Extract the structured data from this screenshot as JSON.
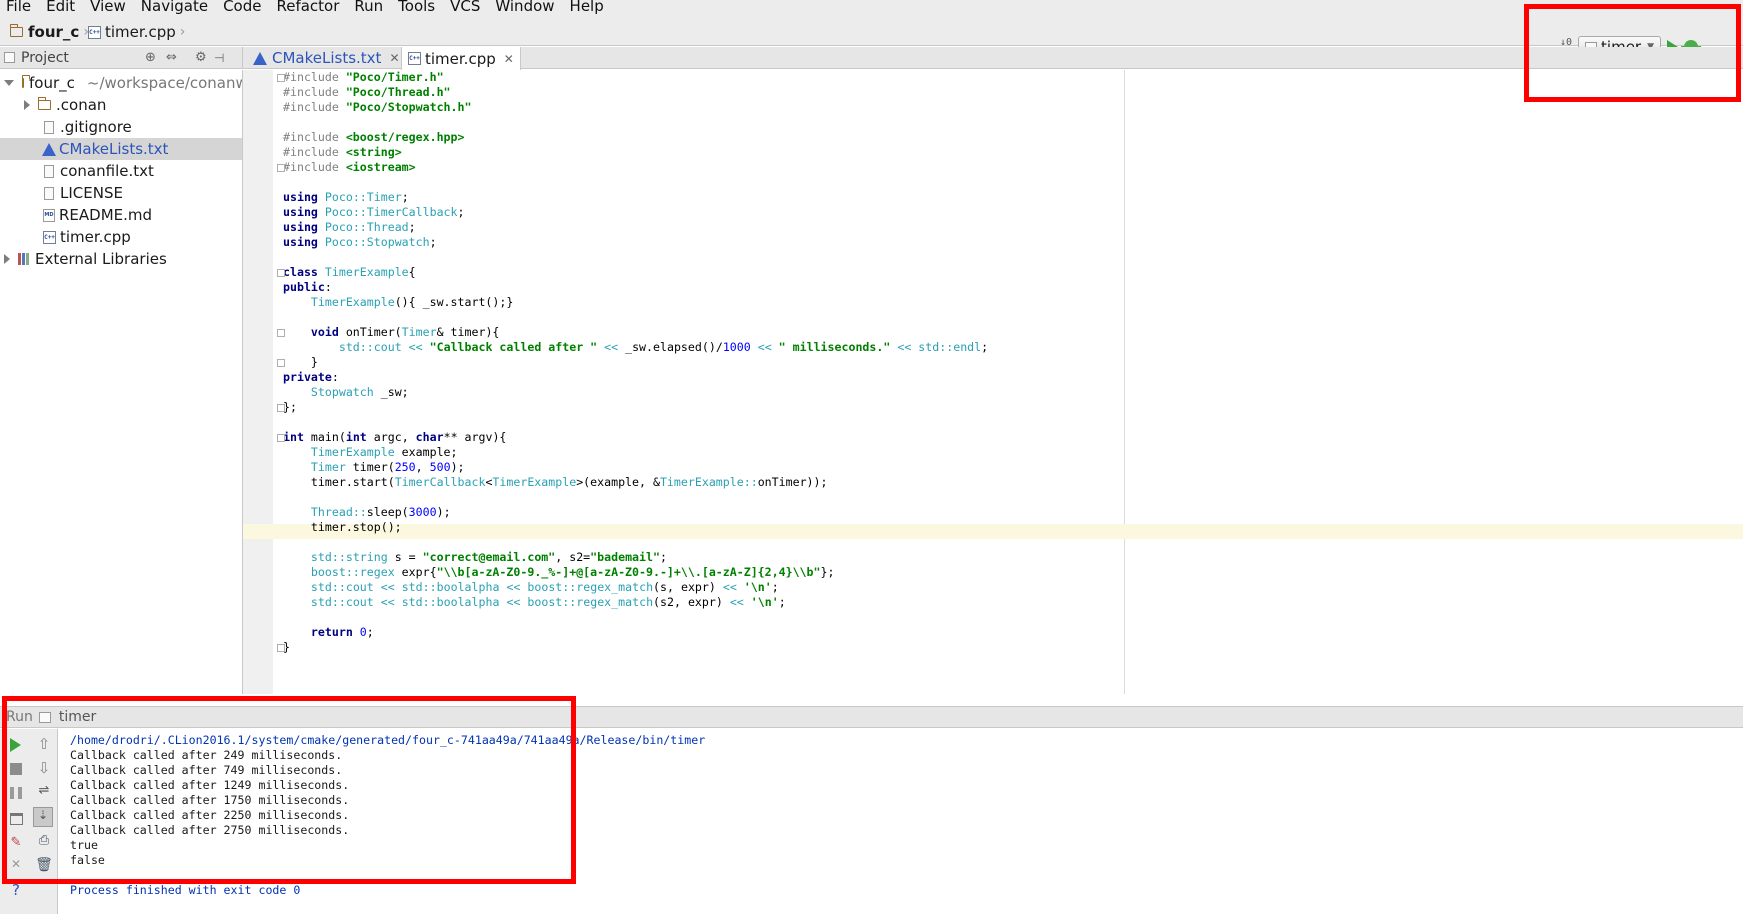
{
  "menu": [
    "File",
    "Edit",
    "View",
    "Navigate",
    "Code",
    "Refactor",
    "Run",
    "Tools",
    "VCS",
    "Window",
    "Help"
  ],
  "breadcrumb": {
    "project": "four_c",
    "file": "timer.cpp"
  },
  "toolbar": {
    "run_config": "timer"
  },
  "project_panel": {
    "title": "Project",
    "root_name": "four_c",
    "root_path": "~/workspace/conanw",
    "items": [
      ".conan",
      ".gitignore",
      "CMakeLists.txt",
      "conanfile.txt",
      "LICENSE",
      "README.md",
      "timer.cpp"
    ],
    "external": "External Libraries"
  },
  "tabs": [
    "CMakeLists.txt",
    "timer.cpp"
  ],
  "code_lines": [
    "#include \"Poco/Timer.h\"",
    "#include \"Poco/Thread.h\"",
    "#include \"Poco/Stopwatch.h\"",
    "",
    "#include <boost/regex.hpp>",
    "#include <string>",
    "#include <iostream>",
    "",
    "using Poco::Timer;",
    "using Poco::TimerCallback;",
    "using Poco::Thread;",
    "using Poco::Stopwatch;",
    "",
    "class TimerExample{",
    "public:",
    "    TimerExample(){ _sw.start();}",
    "",
    "    void onTimer(Timer& timer){",
    "        std::cout << \"Callback called after \" << _sw.elapsed()/1000 << \" milliseconds.\" << std::endl;",
    "    }",
    "private:",
    "    Stopwatch _sw;",
    "};",
    "",
    "int main(int argc, char** argv){",
    "    TimerExample example;",
    "    Timer timer(250, 500);",
    "    timer.start(TimerCallback<TimerExample>(example, &TimerExample::onTimer));",
    "",
    "    Thread::sleep(3000);",
    "    timer.stop();",
    "",
    "    std::string s = \"correct@email.com\", s2=\"bademail\";",
    "    boost::regex expr{\"\\\\b[a-zA-Z0-9._%-]+@[a-zA-Z0-9.-]+\\\\.[a-zA-Z]{2,4}\\\\b\"};",
    "    std::cout << std::boolalpha << boost::regex_match(s, expr) << '\\n';",
    "    std::cout << std::boolalpha << boost::regex_match(s2, expr) << '\\n';",
    "",
    "    return 0;",
    "}"
  ],
  "run_panel": {
    "label": "Run",
    "config": "timer",
    "console": [
      "/home/drodri/.CLion2016.1/system/cmake/generated/four_c-741aa49a/741aa49a/Release/bin/timer",
      "Callback called after 249 milliseconds.",
      "Callback called after 749 milliseconds.",
      "Callback called after 1249 milliseconds.",
      "Callback called after 1750 milliseconds.",
      "Callback called after 2250 milliseconds.",
      "Callback called after 2750 milliseconds.",
      "true",
      "false",
      "",
      "Process finished with exit code 0"
    ]
  },
  "colors": {
    "highlight": "#ff0000",
    "keyword": "#000080",
    "string": "#008000",
    "type": "#2aa1b3",
    "number": "#0000ff"
  }
}
